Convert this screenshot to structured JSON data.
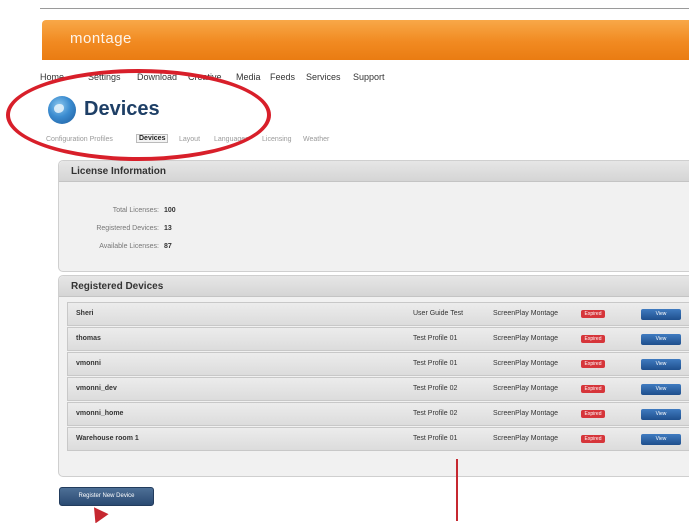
{
  "header": {
    "logo": "montage"
  },
  "nav": {
    "items": [
      "Home",
      "Settings",
      "Download",
      "Creative",
      "Media",
      "Feeds",
      "Services",
      "Support"
    ]
  },
  "page": {
    "title": "Devices"
  },
  "subtabs": [
    "Configuration Profiles",
    "Devices",
    "Layout",
    "Languages",
    "Licensing",
    "Weather"
  ],
  "license": {
    "title": "License Information",
    "rows": [
      {
        "label": "Total Licenses:",
        "value": "100"
      },
      {
        "label": "Registered Devices:",
        "value": "13"
      },
      {
        "label": "Available Licenses:",
        "value": "87"
      }
    ]
  },
  "devices": {
    "title": "Registered Devices",
    "badge_label": "Expired",
    "view_label": "View",
    "rows": [
      {
        "name": "Sheri",
        "profile": "User Guide Test",
        "product": "ScreenPlay Montage"
      },
      {
        "name": "thomas",
        "profile": "Test Profile 01",
        "product": "ScreenPlay Montage"
      },
      {
        "name": "vmonni",
        "profile": "Test Profile 01",
        "product": "ScreenPlay Montage"
      },
      {
        "name": "vmonni_dev",
        "profile": "Test Profile 02",
        "product": "ScreenPlay Montage"
      },
      {
        "name": "vmonni_home",
        "profile": "Test Profile 02",
        "product": "ScreenPlay Montage"
      },
      {
        "name": "Warehouse room 1",
        "profile": "Test Profile 01",
        "product": "ScreenPlay Montage"
      }
    ]
  },
  "actions": {
    "register_label": "Register New Device"
  },
  "colors": {
    "brand_orange": "#f18a21",
    "annotation_red": "#d81f2a",
    "button_blue": "#1e4f8d"
  }
}
